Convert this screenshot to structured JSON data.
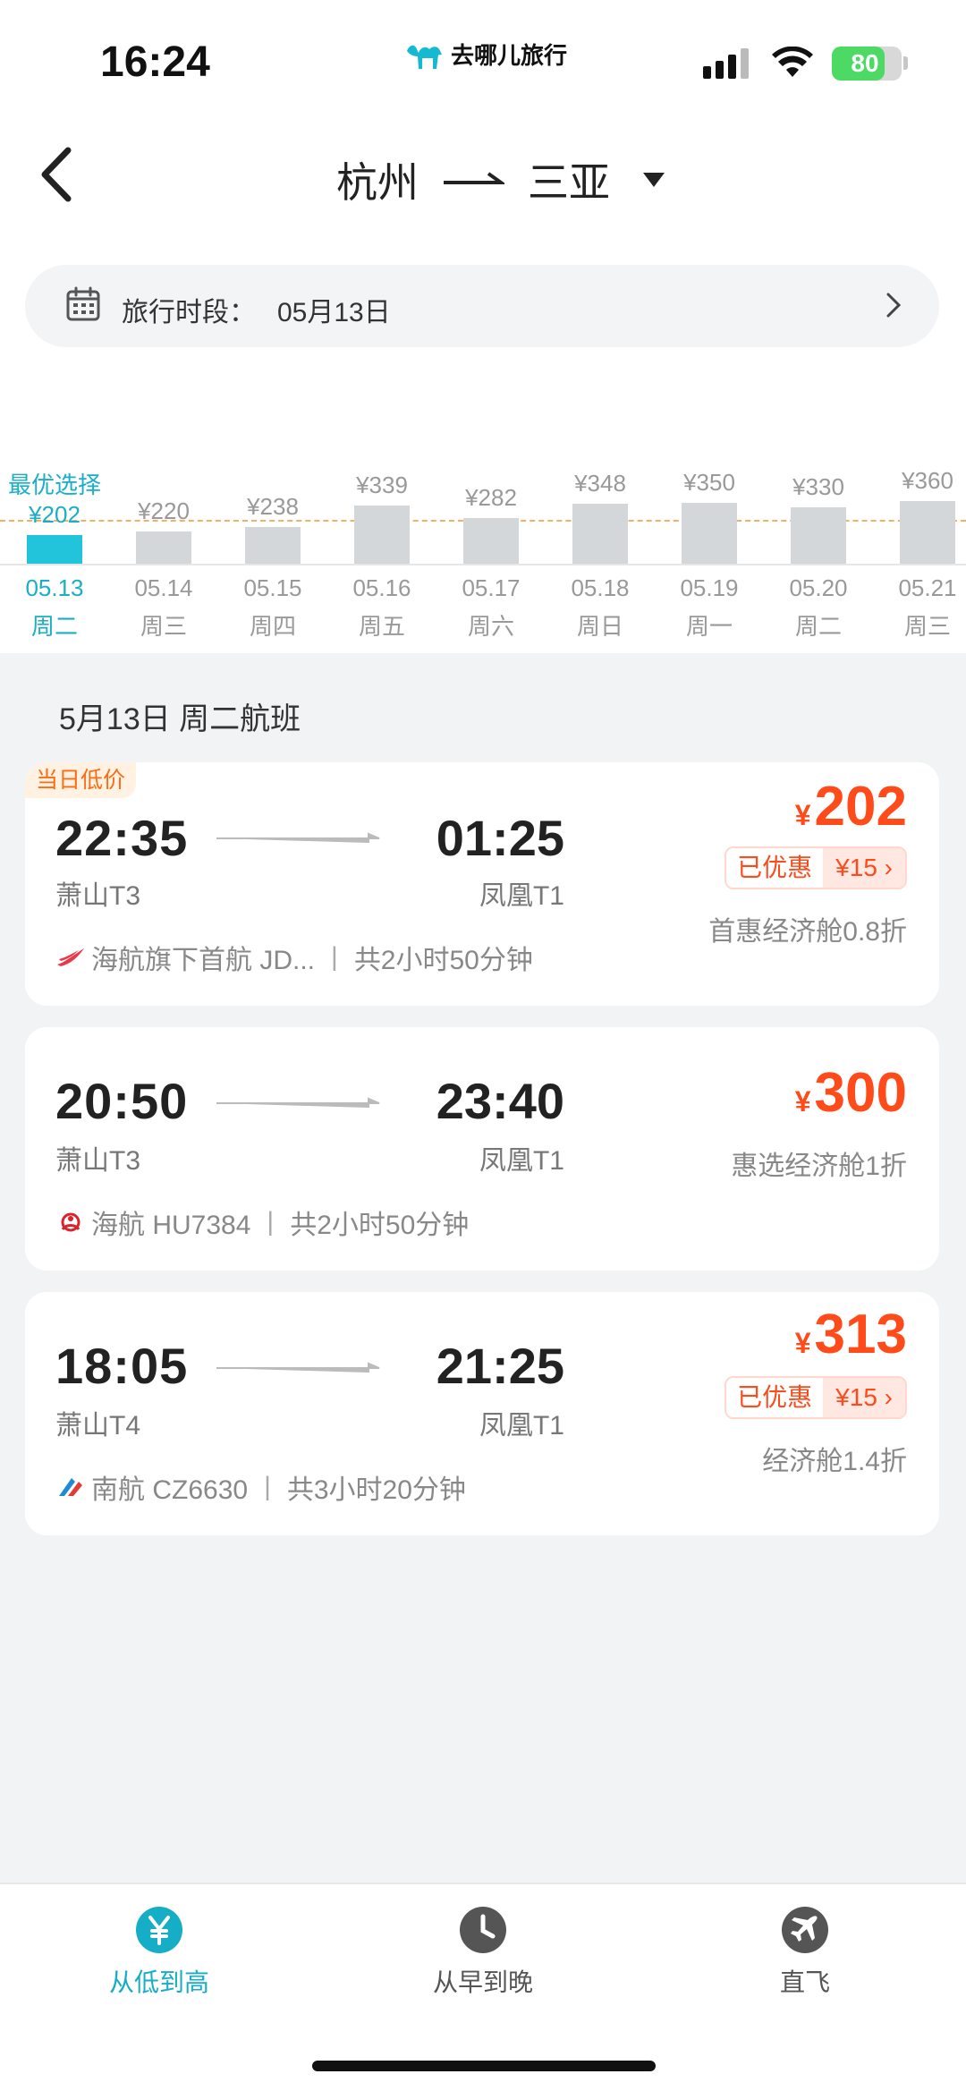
{
  "status": {
    "time": "16:24",
    "brand": "去哪儿旅行",
    "battery": "80",
    "battery_level": 0.8
  },
  "header": {
    "from": "杭州",
    "to": "三亚",
    "back_icon": "chevron-left-icon",
    "dropdown_icon": "caret-down-icon"
  },
  "date_bar": {
    "label": "旅行时段：",
    "value": "05月13日"
  },
  "chart_data": {
    "type": "bar",
    "best_label": "最优选择",
    "reference_price": 202,
    "categories": [
      {
        "date": "05.13",
        "weekday": "周二",
        "price": 202,
        "price_label": "¥202",
        "selected": true
      },
      {
        "date": "05.14",
        "weekday": "周三",
        "price": 220,
        "price_label": "¥220"
      },
      {
        "date": "05.15",
        "weekday": "周四",
        "price": 238,
        "price_label": "¥238"
      },
      {
        "date": "05.16",
        "weekday": "周五",
        "price": 339,
        "price_label": "¥339"
      },
      {
        "date": "05.17",
        "weekday": "周六",
        "price": 282,
        "price_label": "¥282"
      },
      {
        "date": "05.18",
        "weekday": "周日",
        "price": 348,
        "price_label": "¥348"
      },
      {
        "date": "05.19",
        "weekday": "周一",
        "price": 350,
        "price_label": "¥350"
      },
      {
        "date": "05.20",
        "weekday": "周二",
        "price": 330,
        "price_label": "¥330"
      },
      {
        "date": "05.21",
        "weekday": "周三",
        "price": 360,
        "price_label": "¥360"
      }
    ]
  },
  "section_title": "5月13日 周二航班",
  "flights": [
    {
      "tag": "当日低价",
      "dep_time": "22:35",
      "arr_time": "01:25",
      "dep_airport": "萧山T3",
      "arr_airport": "凤凰T1",
      "airline": "海航旗下首航 JD...",
      "duration": "共2小时50分钟",
      "currency": "¥",
      "price": "202",
      "discount_label": "已优惠",
      "discount_value": "¥15",
      "cabin": "首惠经济舱0.8折",
      "logo_color": "#e8394a"
    },
    {
      "dep_time": "20:50",
      "arr_time": "23:40",
      "dep_airport": "萧山T3",
      "arr_airport": "凤凰T1",
      "airline": "海航 HU7384",
      "duration": "共2小时50分钟",
      "currency": "¥",
      "price": "300",
      "cabin": "惠选经济舱1折",
      "logo_color": "#d9232d"
    },
    {
      "dep_time": "18:05",
      "arr_time": "21:25",
      "dep_airport": "萧山T4",
      "arr_airport": "凤凰T1",
      "airline": "南航 CZ6630",
      "duration": "共3小时20分钟",
      "currency": "¥",
      "price": "313",
      "discount_label": "已优惠",
      "discount_value": "¥15",
      "cabin": "经济舱1.4折",
      "logo_color": "#1f8ad6"
    }
  ],
  "tabs": [
    {
      "label": "从低到高",
      "icon": "yen-icon",
      "active": true
    },
    {
      "label": "从早到晚",
      "icon": "clock-icon"
    },
    {
      "label": "直飞",
      "icon": "plane-icon"
    }
  ],
  "colors": {
    "accent": "#16aec7",
    "price": "#ff4a1a",
    "bar": "#d3d7da",
    "bar_selected": "#22c4dc"
  }
}
